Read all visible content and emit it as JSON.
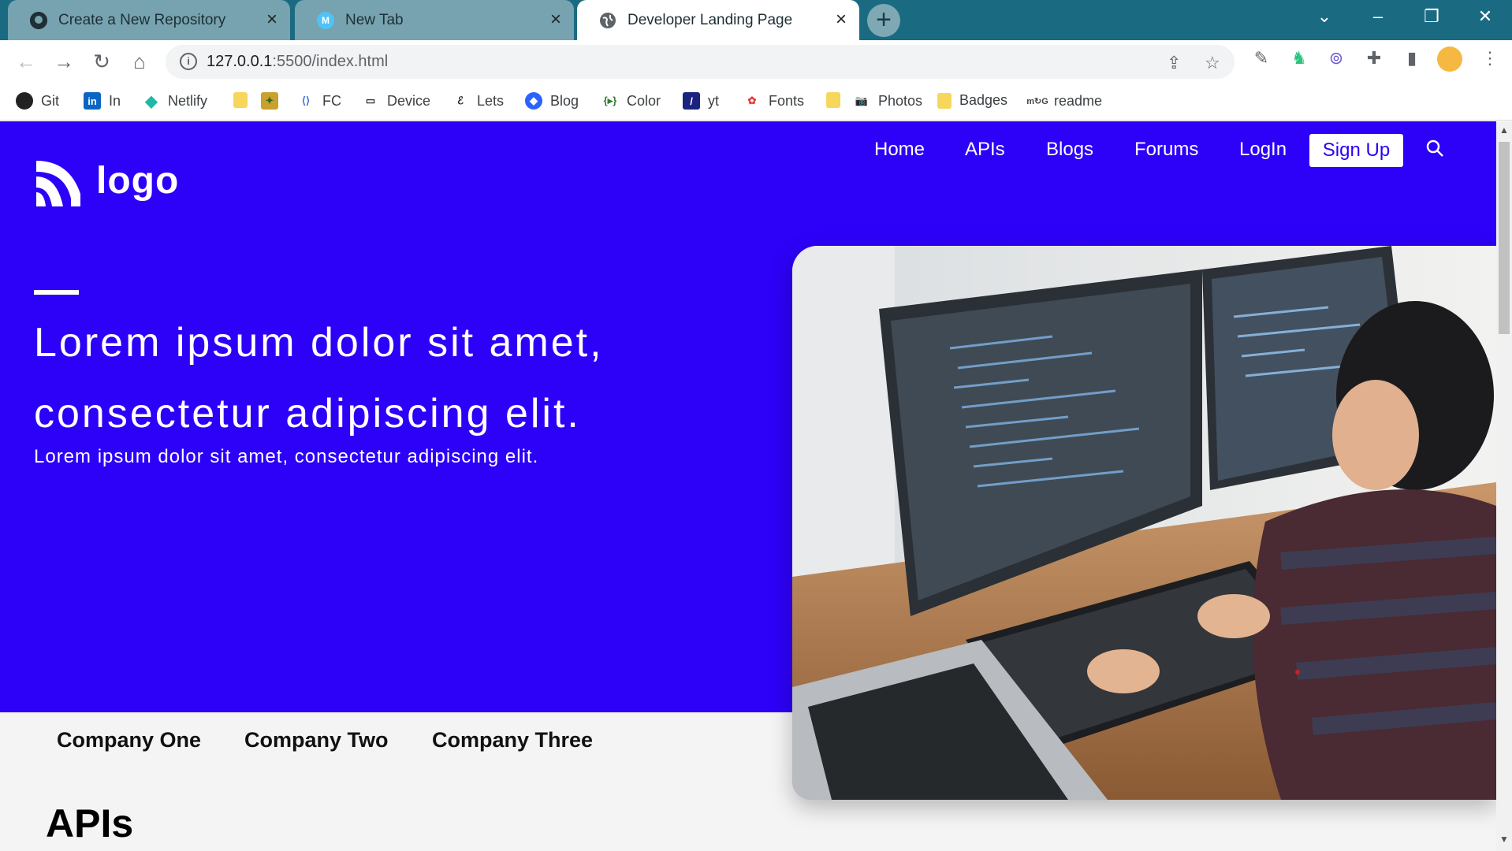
{
  "browser": {
    "tabs": [
      {
        "title": "Create a New Repository",
        "icon": "github-icon"
      },
      {
        "title": "New Tab",
        "icon": "m-icon"
      },
      {
        "title": "Developer Landing Page",
        "icon": "globe-icon"
      }
    ],
    "new_tab_label": "+",
    "url_host": "127.0.0.1",
    "url_path": ":5500/index.html",
    "bookmarks": [
      {
        "label": "Git",
        "icon": "github-icon"
      },
      {
        "label": "In",
        "icon": "linkedin-icon"
      },
      {
        "label": "Netlify",
        "icon": "netlify-icon"
      },
      {
        "label": "",
        "icon": "folder-icon"
      },
      {
        "label": "",
        "icon": "shield-badge-icon"
      },
      {
        "label": "FC",
        "icon": "freecodecamp-icon"
      },
      {
        "label": "Device",
        "icon": "device-icon"
      },
      {
        "label": "Lets",
        "icon": "letsgo-icon"
      },
      {
        "label": "Blog",
        "icon": "blog-icon"
      },
      {
        "label": "Color",
        "icon": "color-icon"
      },
      {
        "label": "yt",
        "icon": "yt-icon"
      },
      {
        "label": "Fonts",
        "icon": "fonts-icon"
      },
      {
        "label": "",
        "icon": "folder-icon"
      },
      {
        "label": "Photos",
        "icon": "camera-icon"
      },
      {
        "label": "Badges",
        "icon": "folder-icon"
      },
      {
        "label": "readme",
        "icon": "mg-icon"
      }
    ],
    "colors": {
      "tabstrip": "#1a6b82",
      "inactive_tab": "#76a3af"
    }
  },
  "page": {
    "logo_text": "logo",
    "nav": [
      "Home",
      "APIs",
      "Blogs",
      "Forums",
      "LogIn"
    ],
    "signup_label": "Sign Up",
    "headline": "Lorem ipsum dolor sit amet, consectetur adipiscing elit.",
    "subheadline": "Lorem ipsum dolor sit amet, consectetur adipiscing elit.",
    "companies": [
      "Company One",
      "Company Two",
      "Company Three"
    ],
    "section_title": "APIs",
    "colors": {
      "hero_bg": "#2d00f7",
      "page_bg": "#f4f4f4"
    }
  }
}
